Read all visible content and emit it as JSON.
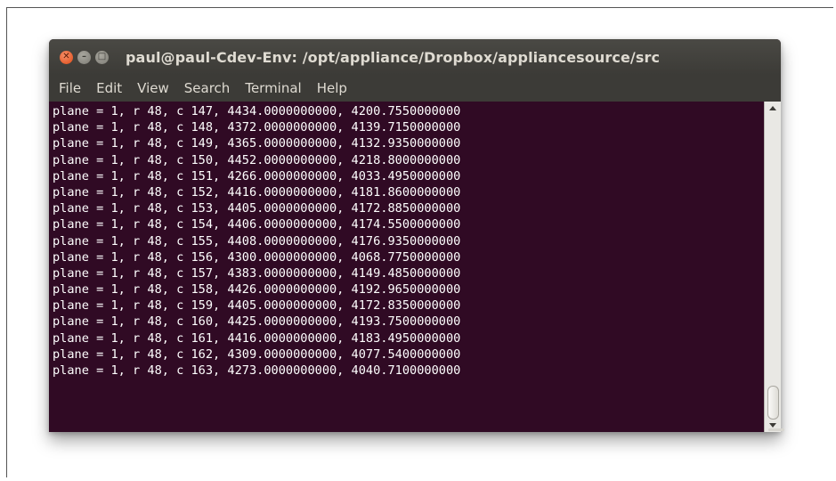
{
  "window": {
    "title": "paul@paul-Cdev-Env: /opt/appliance/Dropbox/appliancesource/src",
    "buttons": {
      "close_glyph": "✕",
      "minimize_glyph": "–",
      "maximize_glyph": "□"
    }
  },
  "menu": {
    "items": [
      "File",
      "Edit",
      "View",
      "Search",
      "Terminal",
      "Help"
    ]
  },
  "terminal": {
    "background": "#300a24",
    "foreground": "#ffffff",
    "lines": [
      "plane = 1, r 48, c 147, 4434.0000000000, 4200.7550000000",
      "plane = 1, r 48, c 148, 4372.0000000000, 4139.7150000000",
      "plane = 1, r 48, c 149, 4365.0000000000, 4132.9350000000",
      "plane = 1, r 48, c 150, 4452.0000000000, 4218.8000000000",
      "plane = 1, r 48, c 151, 4266.0000000000, 4033.4950000000",
      "plane = 1, r 48, c 152, 4416.0000000000, 4181.8600000000",
      "plane = 1, r 48, c 153, 4405.0000000000, 4172.8850000000",
      "plane = 1, r 48, c 154, 4406.0000000000, 4174.5500000000",
      "plane = 1, r 48, c 155, 4408.0000000000, 4176.9350000000",
      "plane = 1, r 48, c 156, 4300.0000000000, 4068.7750000000",
      "plane = 1, r 48, c 157, 4383.0000000000, 4149.4850000000",
      "plane = 1, r 48, c 158, 4426.0000000000, 4192.9650000000",
      "plane = 1, r 48, c 159, 4405.0000000000, 4172.8350000000",
      "plane = 1, r 48, c 160, 4425.0000000000, 4193.7500000000",
      "plane = 1, r 48, c 161, 4416.0000000000, 4183.4950000000",
      "plane = 1, r 48, c 162, 4309.0000000000, 4077.5400000000",
      "plane = 1, r 48, c 163, 4273.0000000000, 4040.7100000000"
    ]
  },
  "scrollbar": {
    "position_fraction": 0.95
  },
  "colors": {
    "close_button": "#df4a16",
    "titlebar": "#3c3b37",
    "title_text": "#dfdbd2"
  }
}
